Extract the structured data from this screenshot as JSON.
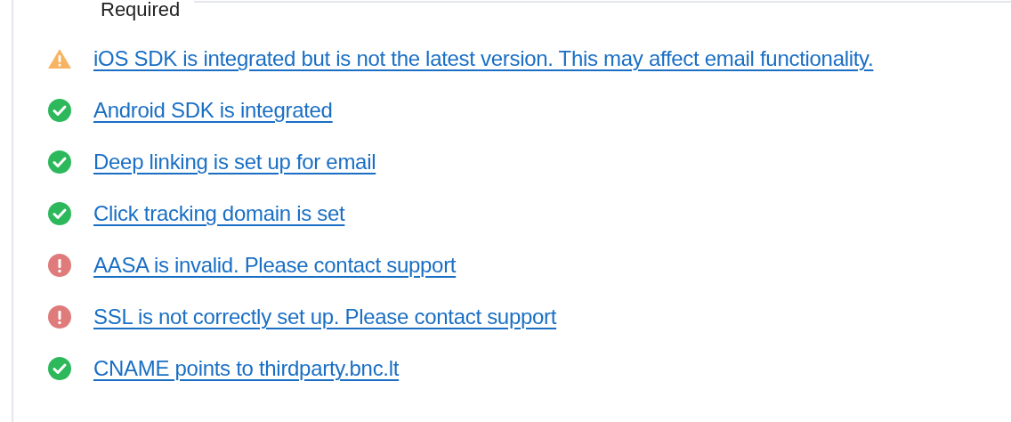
{
  "section": {
    "legend": "Required"
  },
  "checks": [
    {
      "kind": "warning",
      "label": "iOS SDK is integrated but is not the latest version. This may affect email functionality."
    },
    {
      "kind": "ok",
      "label": "Android SDK is integrated"
    },
    {
      "kind": "ok",
      "label": "Deep linking is set up for email"
    },
    {
      "kind": "ok",
      "label": "Click tracking domain is set"
    },
    {
      "kind": "error",
      "label": "AASA is invalid. Please contact support"
    },
    {
      "kind": "error",
      "label": "SSL is not correctly set up. Please contact support"
    },
    {
      "kind": "ok",
      "label": "CNAME points to thirdparty.bnc.lt"
    }
  ]
}
